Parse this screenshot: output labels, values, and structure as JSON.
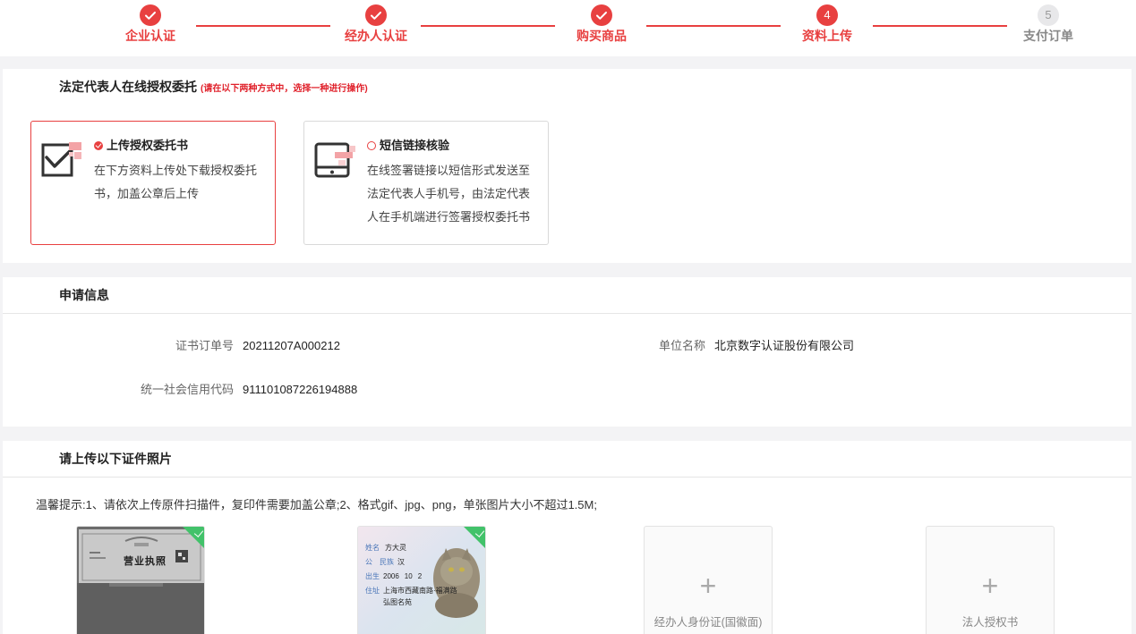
{
  "steps": [
    {
      "label": "企业认证",
      "status": "done"
    },
    {
      "label": "经办人认证",
      "status": "done"
    },
    {
      "label": "购买商品",
      "status": "done"
    },
    {
      "label": "资料上传",
      "status": "current",
      "number": "4"
    },
    {
      "label": "支付订单",
      "status": "pending",
      "number": "5"
    }
  ],
  "auth": {
    "title": "法定代表人在线授权委托",
    "hint": "(请在以下两种方式中，选择一种进行操作)",
    "option_upload": {
      "title": "上传授权委托书",
      "desc_line1": "在下方资料上传处下载授权委托",
      "desc_line2": "书，加盖公章后上传"
    },
    "option_sms": {
      "title": "短信链接核验",
      "desc_line1": "在线签署链接以短信形式发送至",
      "desc_line2": "法定代表人手机号，由法定代表",
      "desc_line3": "人在手机端进行签署授权委托书"
    }
  },
  "info": {
    "title": "申请信息",
    "order_label": "证书订单号",
    "order_value": "20211207A000212",
    "company_label": "单位名称",
    "company_value": "北京数字认证股份有限公司",
    "credit_label": "统一社会信用代码",
    "credit_value": "911101087226194888"
  },
  "upload": {
    "title": "请上传以下证件照片",
    "tip": "温馨提示:1、请依次上传原件扫描件，复印件需要加盖公章;2、格式gif、jpg、png，单张图片大小不超过1.5M;",
    "license_text": "营业执照",
    "id_name_label": "姓名",
    "id_name": "方大灵",
    "id_gender": "公",
    "id_ethnic_label": "民族",
    "id_ethnic": "汉",
    "id_birth_label": "出生",
    "id_birth": "2006",
    "id_month": "10",
    "id_day": "2",
    "id_address_label": "住址",
    "id_address1": "上海市西藏南路·福满路",
    "id_address2": "弘图名苑",
    "box3_label": "经办人身份证(国徽面)",
    "box4_label": "法人授权书"
  },
  "colors": {
    "accent": "#e84040",
    "success": "#42c26a"
  }
}
